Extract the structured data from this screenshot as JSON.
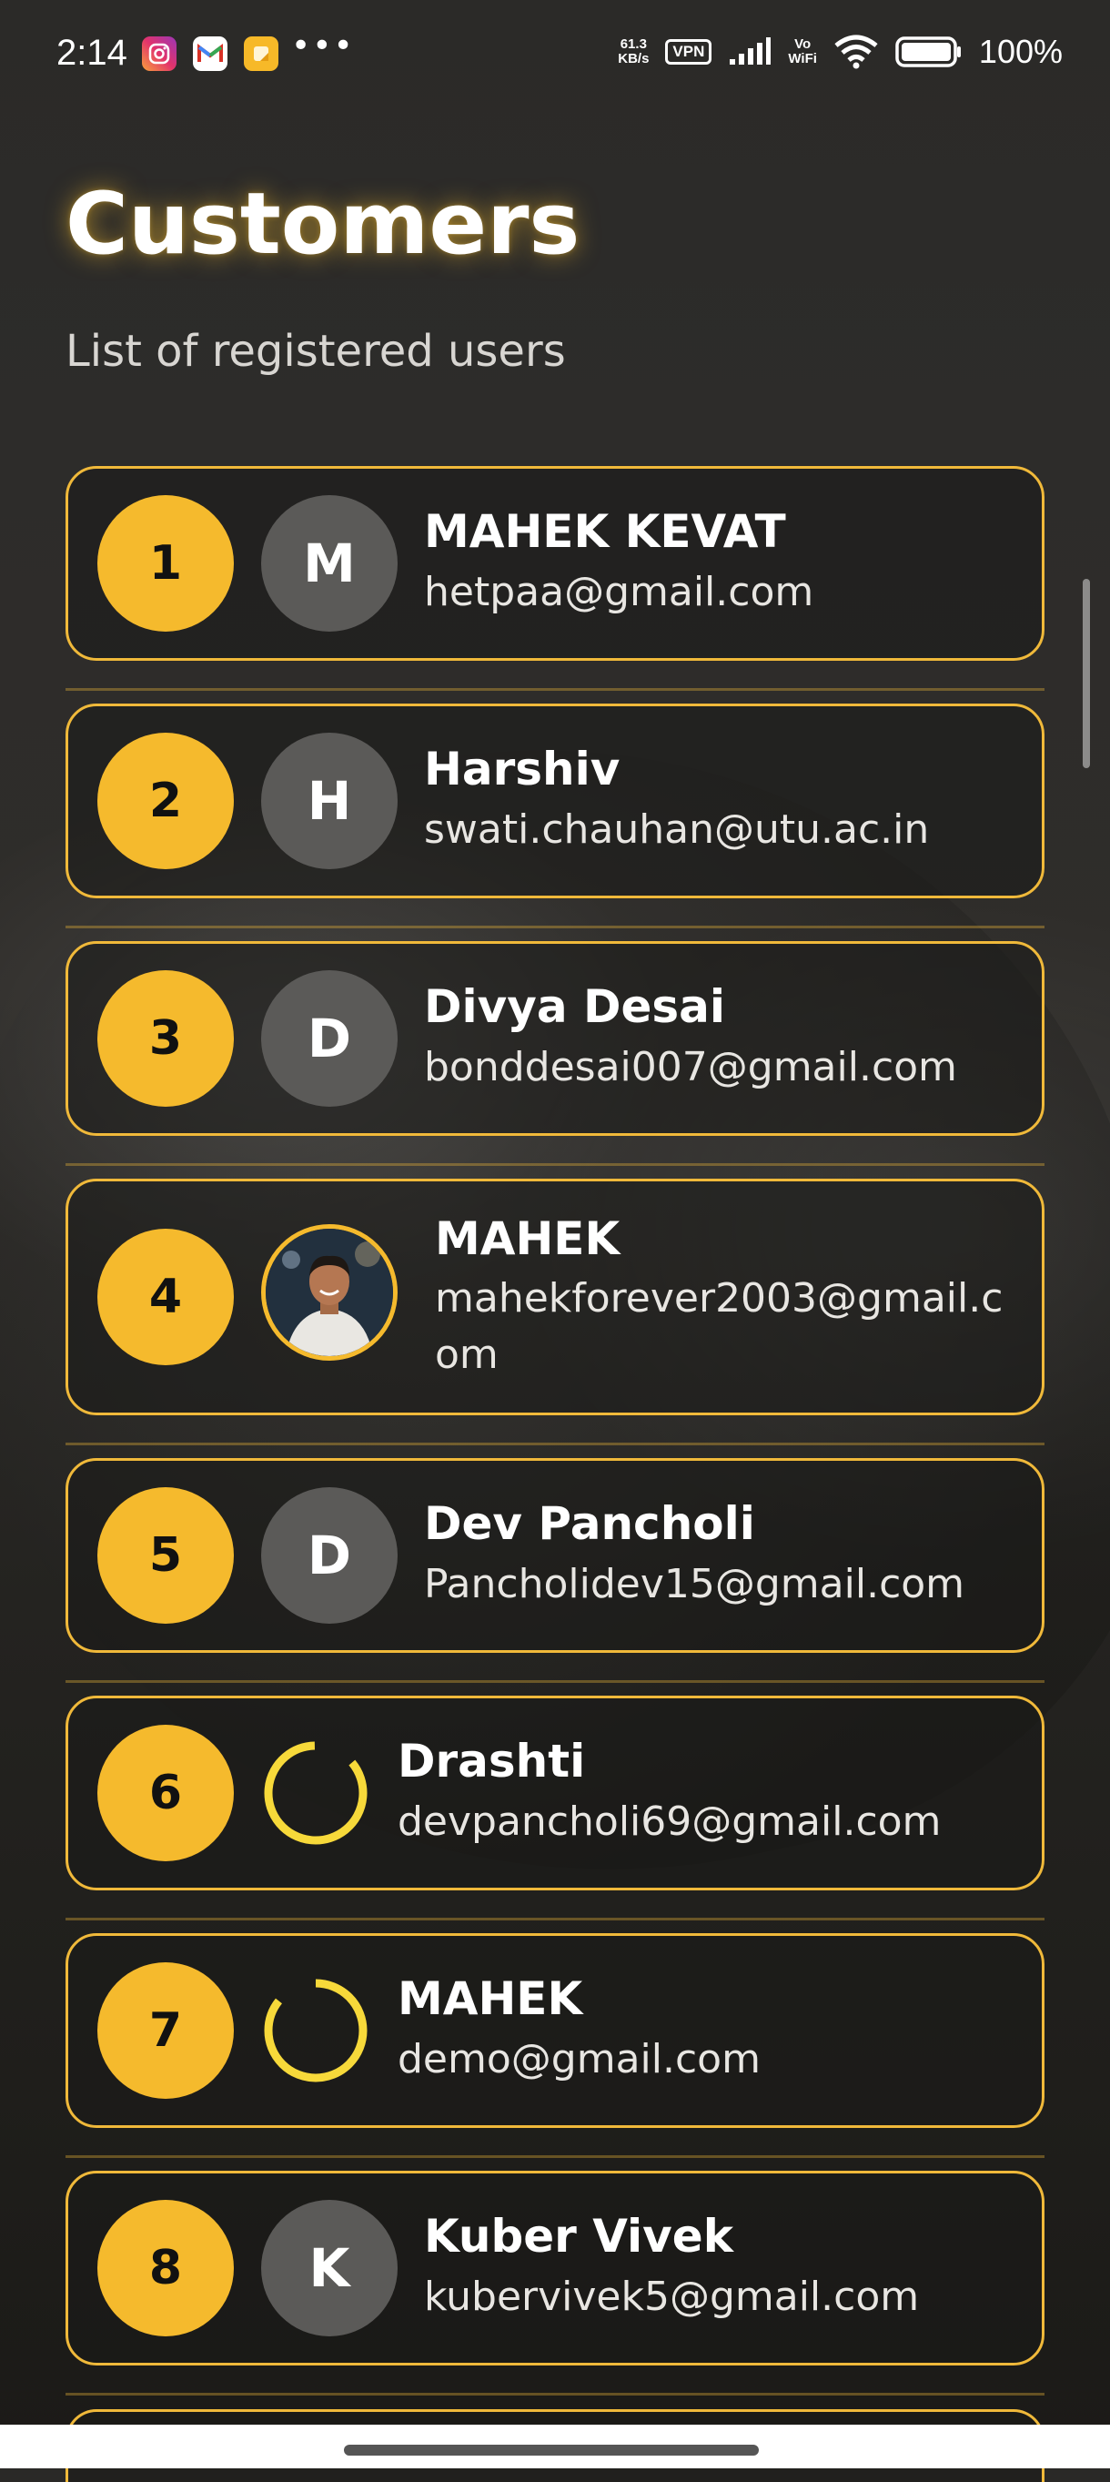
{
  "status_bar": {
    "time": "2:14",
    "apps": [
      "instagram-icon",
      "gmail-icon",
      "notes-icon"
    ],
    "more": "•••",
    "net_speed_value": "61.3",
    "net_speed_unit": "KB/s",
    "vpn": "VPN",
    "vowifi_top": "Vo",
    "vowifi_bottom": "WiFi",
    "battery": "100%"
  },
  "header": {
    "title": "Customers",
    "subtitle": "List of registered users"
  },
  "customers": [
    {
      "rank": "1",
      "initial": "M",
      "name": "MAHEK KEVAT",
      "email": "hetpaa@gmail.com",
      "avatar": "initial"
    },
    {
      "rank": "2",
      "initial": "H",
      "name": "Harshiv",
      "email": "swati.chauhan@utu.ac.in",
      "avatar": "initial"
    },
    {
      "rank": "3",
      "initial": "D",
      "name": "Divya Desai",
      "email": "bonddesai007@gmail.com",
      "avatar": "initial"
    },
    {
      "rank": "4",
      "initial": "",
      "name": "MAHEK",
      "email": "mahekforever2003@gmail.com",
      "avatar": "photo"
    },
    {
      "rank": "5",
      "initial": "D",
      "name": "Dev Pancholi",
      "email": "Pancholidev15@gmail.com",
      "avatar": "initial"
    },
    {
      "rank": "6",
      "initial": "",
      "name": "Drashti",
      "email": "devpancholi69@gmail.com",
      "avatar": "loading"
    },
    {
      "rank": "7",
      "initial": "",
      "name": "MAHEK",
      "email": "demo@gmail.com",
      "avatar": "loading"
    },
    {
      "rank": "8",
      "initial": "K",
      "name": "Kuber Vivek",
      "email": "kubervivek5@gmail.com",
      "avatar": "initial"
    }
  ],
  "colors": {
    "accent": "#f5ba2d",
    "card_border": "#f0b93a",
    "avatar_bg": "#5b5a58",
    "background": "#2a2927"
  }
}
